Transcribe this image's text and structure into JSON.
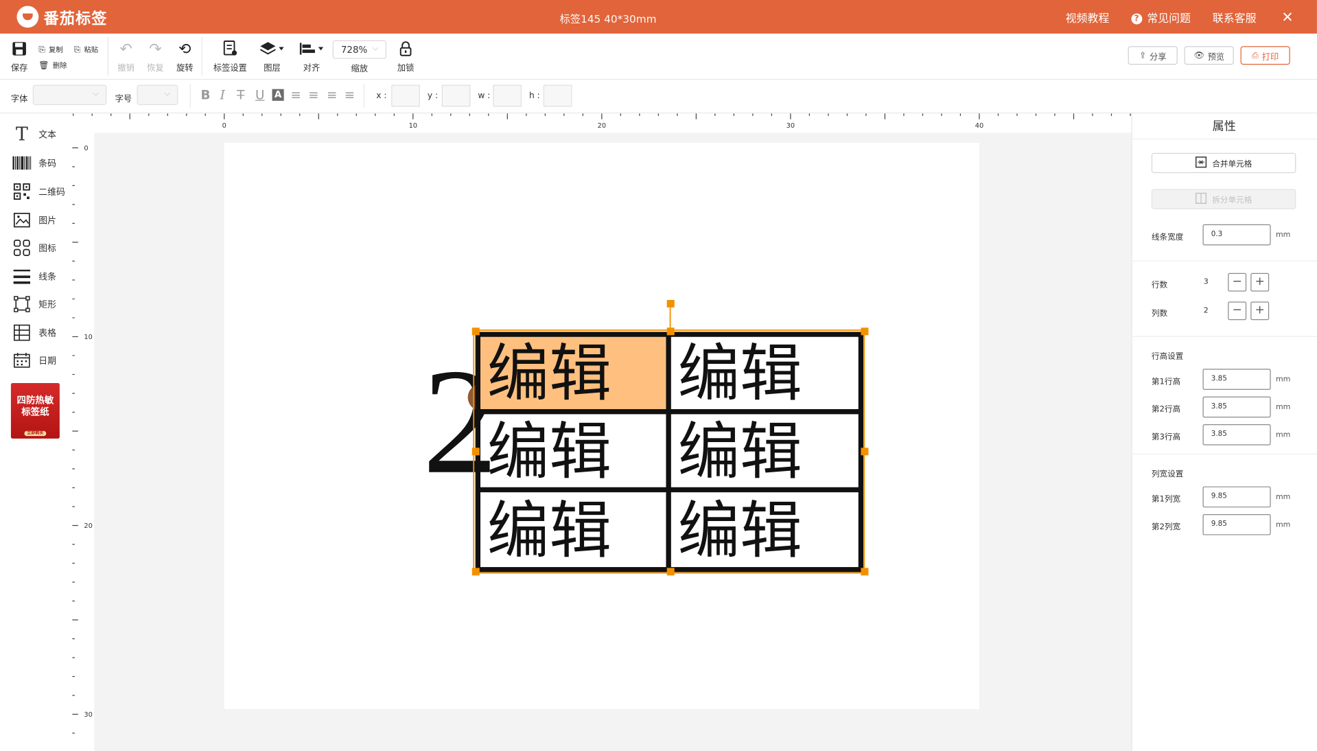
{
  "app": {
    "brand": "番茄标签",
    "doc_title": "标签145",
    "doc_size": "40*30mm",
    "links": [
      "视频教程",
      "常见问题",
      "联系客服"
    ]
  },
  "toolbar": {
    "save": "保存",
    "copy": "复制",
    "paste": "粘贴",
    "delete": "删除",
    "undo": "撤销",
    "redo": "恢复",
    "rotate": "旋转",
    "label_settings": "标签设置",
    "layers": "图层",
    "align": "对齐",
    "zoom_value": "728%",
    "zoom_label": "缩放",
    "lock": "加锁",
    "share": "分享",
    "preview": "预览",
    "print": "打印"
  },
  "format_bar": {
    "font_label": "字体",
    "size_label": "字号",
    "x_label": "x :",
    "y_label": "y :",
    "w_label": "w :",
    "h_label": "h :"
  },
  "left_tools": [
    {
      "label": "文本",
      "icon": "text-icon"
    },
    {
      "label": "条码",
      "icon": "barcode-icon"
    },
    {
      "label": "二维码",
      "icon": "qrcode-icon"
    },
    {
      "label": "图片",
      "icon": "image-icon"
    },
    {
      "label": "图标",
      "icon": "icons-icon"
    },
    {
      "label": "线条",
      "icon": "lines-icon"
    },
    {
      "label": "矩形",
      "icon": "rectangle-icon"
    },
    {
      "label": "表格",
      "icon": "table-icon"
    },
    {
      "label": "日期",
      "icon": "date-icon"
    }
  ],
  "promo": {
    "line1": "四防热敏",
    "line2": "标签纸",
    "button": "立即购买"
  },
  "rulers": {
    "h_labels": [
      "0",
      "10",
      "20",
      "30",
      "40"
    ],
    "v_labels": [
      "0",
      "10",
      "20",
      "30"
    ]
  },
  "canvas": {
    "stray_char": "2",
    "table_cells": [
      "编辑",
      "编辑",
      "编辑",
      "编辑",
      "编辑",
      "编辑"
    ],
    "highlight_color": "#ffc07f",
    "handle_color": "#f29100"
  },
  "properties": {
    "title": "属性",
    "merge_cells": "合并单元格",
    "split_cells": "拆分单元格",
    "line_width_label": "线条宽度",
    "line_width_value": "0.3",
    "unit": "mm",
    "rows_label": "行数",
    "rows_value": "3",
    "cols_label": "列数",
    "cols_value": "2",
    "row_height_section": "行高设置",
    "row_heights": [
      {
        "label": "第1行高",
        "value": "3.85"
      },
      {
        "label": "第2行高",
        "value": "3.85"
      },
      {
        "label": "第3行高",
        "value": "3.85"
      }
    ],
    "col_width_section": "列宽设置",
    "col_widths": [
      {
        "label": "第1列宽",
        "value": "9.85"
      },
      {
        "label": "第2列宽",
        "value": "9.85"
      }
    ]
  },
  "colors": {
    "accent": "#e2643a"
  }
}
